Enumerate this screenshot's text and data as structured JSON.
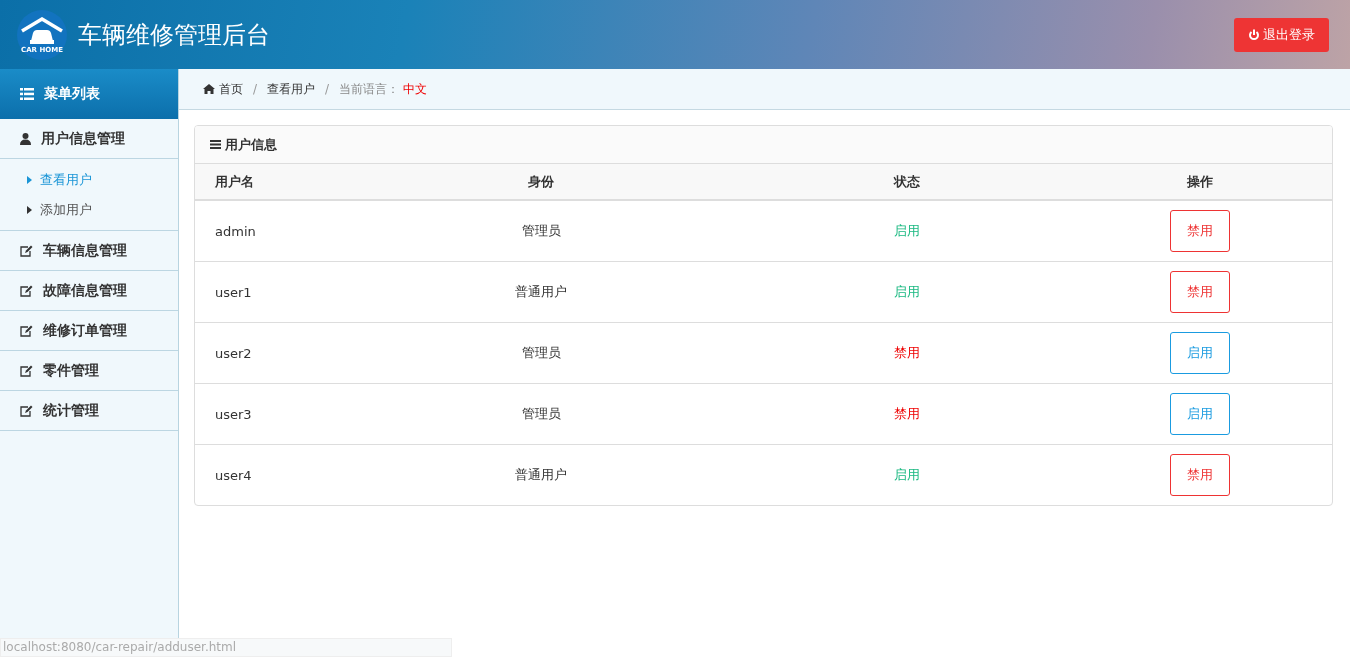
{
  "header": {
    "title": "车辆维修管理后台",
    "logo_text": "CAR HOME",
    "logout": "退出登录"
  },
  "sidebar": {
    "title": "菜单列表",
    "items": [
      {
        "label": "用户信息管理",
        "kind": "user",
        "children": [
          {
            "label": "查看用户",
            "selected": true
          },
          {
            "label": "添加用户",
            "selected": false
          }
        ]
      },
      {
        "label": "车辆信息管理",
        "kind": "edit"
      },
      {
        "label": "故障信息管理",
        "kind": "edit"
      },
      {
        "label": "维修订单管理",
        "kind": "edit"
      },
      {
        "label": "零件管理",
        "kind": "edit"
      },
      {
        "label": "统计管理",
        "kind": "edit"
      }
    ]
  },
  "breadcrumb": {
    "home": "首页",
    "separators": [
      "/",
      "/"
    ],
    "current": "查看用户",
    "language_label": "当前语言：",
    "language": "中文"
  },
  "panel": {
    "title": "用户信息",
    "columns": [
      "用户名",
      "身份",
      "状态",
      "操作"
    ],
    "rows": [
      {
        "username": "admin",
        "role": "管理员",
        "status": "启用",
        "enabled": true,
        "action": "禁用"
      },
      {
        "username": "user1",
        "role": "普通用户",
        "status": "启用",
        "enabled": true,
        "action": "禁用"
      },
      {
        "username": "user2",
        "role": "管理员",
        "status": "禁用",
        "enabled": false,
        "action": "启用"
      },
      {
        "username": "user3",
        "role": "管理员",
        "status": "禁用",
        "enabled": false,
        "action": "启用"
      },
      {
        "username": "user4",
        "role": "普通用户",
        "status": "启用",
        "enabled": true,
        "action": "禁用"
      }
    ]
  },
  "status_url": "localhost:8080/car-repair/adduser.html"
}
